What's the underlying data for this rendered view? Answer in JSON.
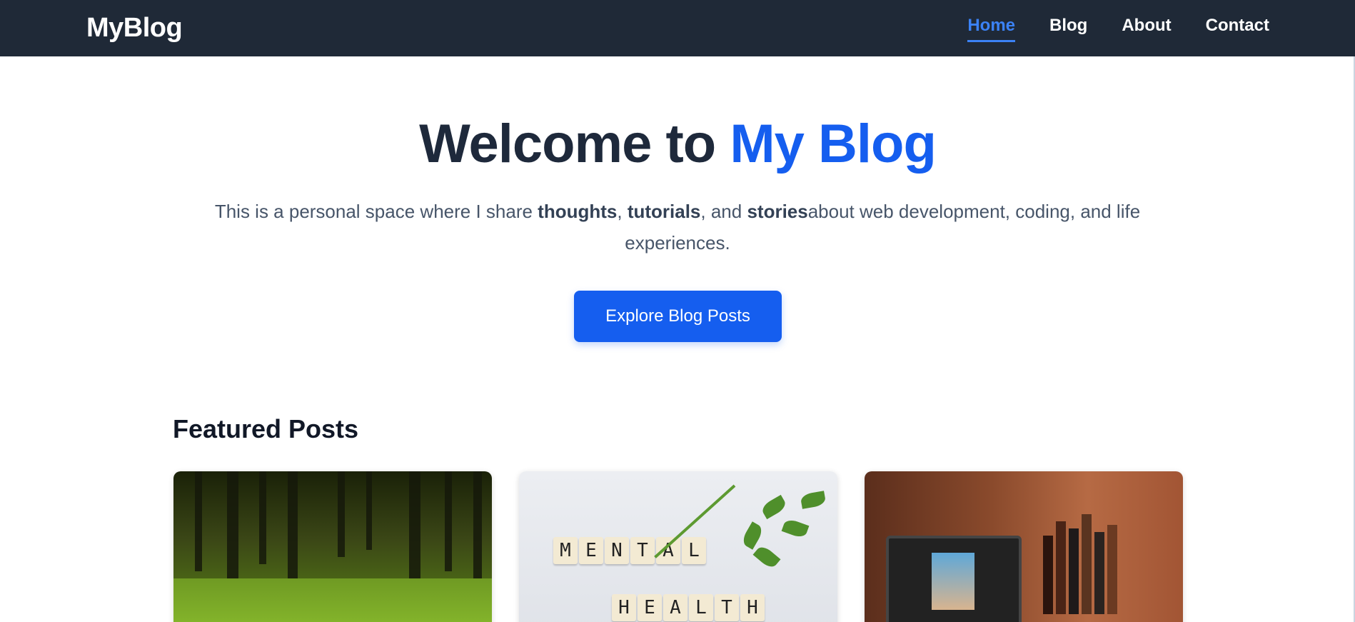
{
  "navbar": {
    "brand": "MyBlog",
    "links": [
      {
        "label": "Home",
        "active": true
      },
      {
        "label": "Blog",
        "active": false
      },
      {
        "label": "About",
        "active": false
      },
      {
        "label": "Contact",
        "active": false
      }
    ]
  },
  "hero": {
    "title_prefix": "Welcome to ",
    "title_accent": "My Blog",
    "text": {
      "part1": "This is a personal space where I share ",
      "bold1": "thoughts",
      "part2": ", ",
      "bold2": "tutorials",
      "part3": ", and ",
      "bold3": "stories",
      "part4": "about web development, coding, and life experiences."
    },
    "cta_label": "Explore Blog Posts"
  },
  "featured": {
    "heading": "Featured Posts",
    "cards": [
      {
        "name": "forest"
      },
      {
        "name": "mental-health",
        "tiles_row1": [
          "M",
          "E",
          "N",
          "T",
          "A",
          "L"
        ],
        "tiles_row2": [
          "H",
          "E",
          "A",
          "L",
          "T",
          "H"
        ]
      },
      {
        "name": "desk"
      }
    ]
  },
  "colors": {
    "navbar_bg": "#1f2937",
    "accent": "#155eef",
    "active_link": "#3b82f6"
  }
}
